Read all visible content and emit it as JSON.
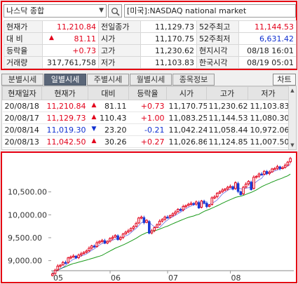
{
  "header": {
    "index_name": "나스닥 종합",
    "market_label": "[미국]:NASDAQ national market"
  },
  "quote": {
    "rows": [
      [
        {
          "label": "현재가"
        },
        {
          "value": "11,210.84",
          "color": "red"
        },
        {
          "label": "전일종가"
        },
        {
          "value": "11,129.73"
        },
        {
          "label": "52주최고"
        },
        {
          "value": "11,144.53",
          "color": "red"
        }
      ],
      [
        {
          "label": "대    비"
        },
        {
          "value": "81.11",
          "color": "red",
          "arrow": "▲"
        },
        {
          "label": "시가"
        },
        {
          "value": "11,170.75"
        },
        {
          "label": "52주최저"
        },
        {
          "value": "6,631.42",
          "color": "blue"
        }
      ],
      [
        {
          "label": "등락율"
        },
        {
          "value": "+0.73",
          "color": "red"
        },
        {
          "label": "고가"
        },
        {
          "value": "11,230.62"
        },
        {
          "label": "현지시각"
        },
        {
          "value": "08/18 16:01"
        }
      ],
      [
        {
          "label": "거래량"
        },
        {
          "value": "317,761,758"
        },
        {
          "label": "저가"
        },
        {
          "value": "11,103.83"
        },
        {
          "label": "한국시각"
        },
        {
          "value": "08/19 05:01"
        }
      ]
    ]
  },
  "tabs": [
    "분별시세",
    "일별시세",
    "주별시세",
    "월별시세",
    "종목정보"
  ],
  "active_tab": "일별시세",
  "chart_button_label": "차트",
  "daily": {
    "columns": [
      "현재일자",
      "현재가",
      "대비",
      "등락율",
      "시가",
      "고가",
      "저가"
    ],
    "rows": [
      {
        "date": "20/08/18",
        "close": "11,210.84",
        "arrow": "▲",
        "change": "81.11",
        "rate": "+0.73",
        "open": "11,170.75",
        "high": "11,230.62",
        "low": "11,103.83",
        "color": "red"
      },
      {
        "date": "20/08/17",
        "close": "11,129.73",
        "arrow": "▲",
        "change": "110.43",
        "rate": "+1.00",
        "open": "11,083.25",
        "high": "11,144.53",
        "low": "11,080.30",
        "color": "red"
      },
      {
        "date": "20/08/14",
        "close": "11,019.30",
        "arrow": "▼",
        "change": "23.20",
        "rate": "-0.21",
        "open": "11,042.24",
        "high": "11,058.44",
        "low": "10,972.06",
        "color": "blue"
      },
      {
        "date": "20/08/13",
        "close": "11,042.50",
        "arrow": "▲",
        "change": "30.26",
        "rate": "+0.27",
        "open": "11,026.86",
        "high": "11,124.85",
        "low": "11,007.50",
        "color": "red"
      }
    ]
  },
  "chart_data": {
    "type": "line",
    "x_tick_labels": [
      "05",
      "06",
      "07",
      "08"
    ],
    "y_tick_labels": [
      "10,500.00",
      "10,000.00",
      "9,500.00",
      "9,000.00"
    ],
    "y_ticks": [
      10500,
      10000,
      9500,
      9000
    ],
    "ylim": [
      8780,
      11260
    ],
    "grid": false,
    "colors": {
      "up": "#e2001a",
      "down": "#1a3bd6",
      "ma_short": "#2a2ad6",
      "ma_long": "#1a9a1a"
    },
    "series": [
      {
        "values": [
          8710,
          8790,
          8880,
          8900,
          8960,
          8950,
          9060,
          9080,
          9100,
          9060,
          9120,
          9150,
          9180,
          9210,
          9270,
          9320,
          9300,
          9390,
          9420,
          9440,
          9380,
          9420,
          9480,
          9510,
          9550,
          9460,
          9500,
          9580,
          9620,
          9650,
          9700,
          9740,
          9810,
          9930,
          9950,
          9830,
          9880,
          9600,
          9650,
          9720,
          9780,
          9860,
          9900,
          9950,
          9940,
          9980,
          10020,
          10060,
          10120,
          10100,
          10180,
          10200,
          10230,
          10250,
          10230,
          10280,
          10150,
          10300,
          10260,
          10180,
          10210,
          10370,
          10390,
          10470,
          10500,
          10540,
          10560,
          10600,
          10620,
          10560,
          10700,
          10510,
          10440,
          10600,
          10670,
          10730,
          10550,
          10820,
          10840,
          10890,
          10880,
          10950,
          10900,
          10930,
          11000,
          11010,
          11050,
          11010,
          11030,
          11080,
          11150,
          11230
        ]
      }
    ]
  }
}
